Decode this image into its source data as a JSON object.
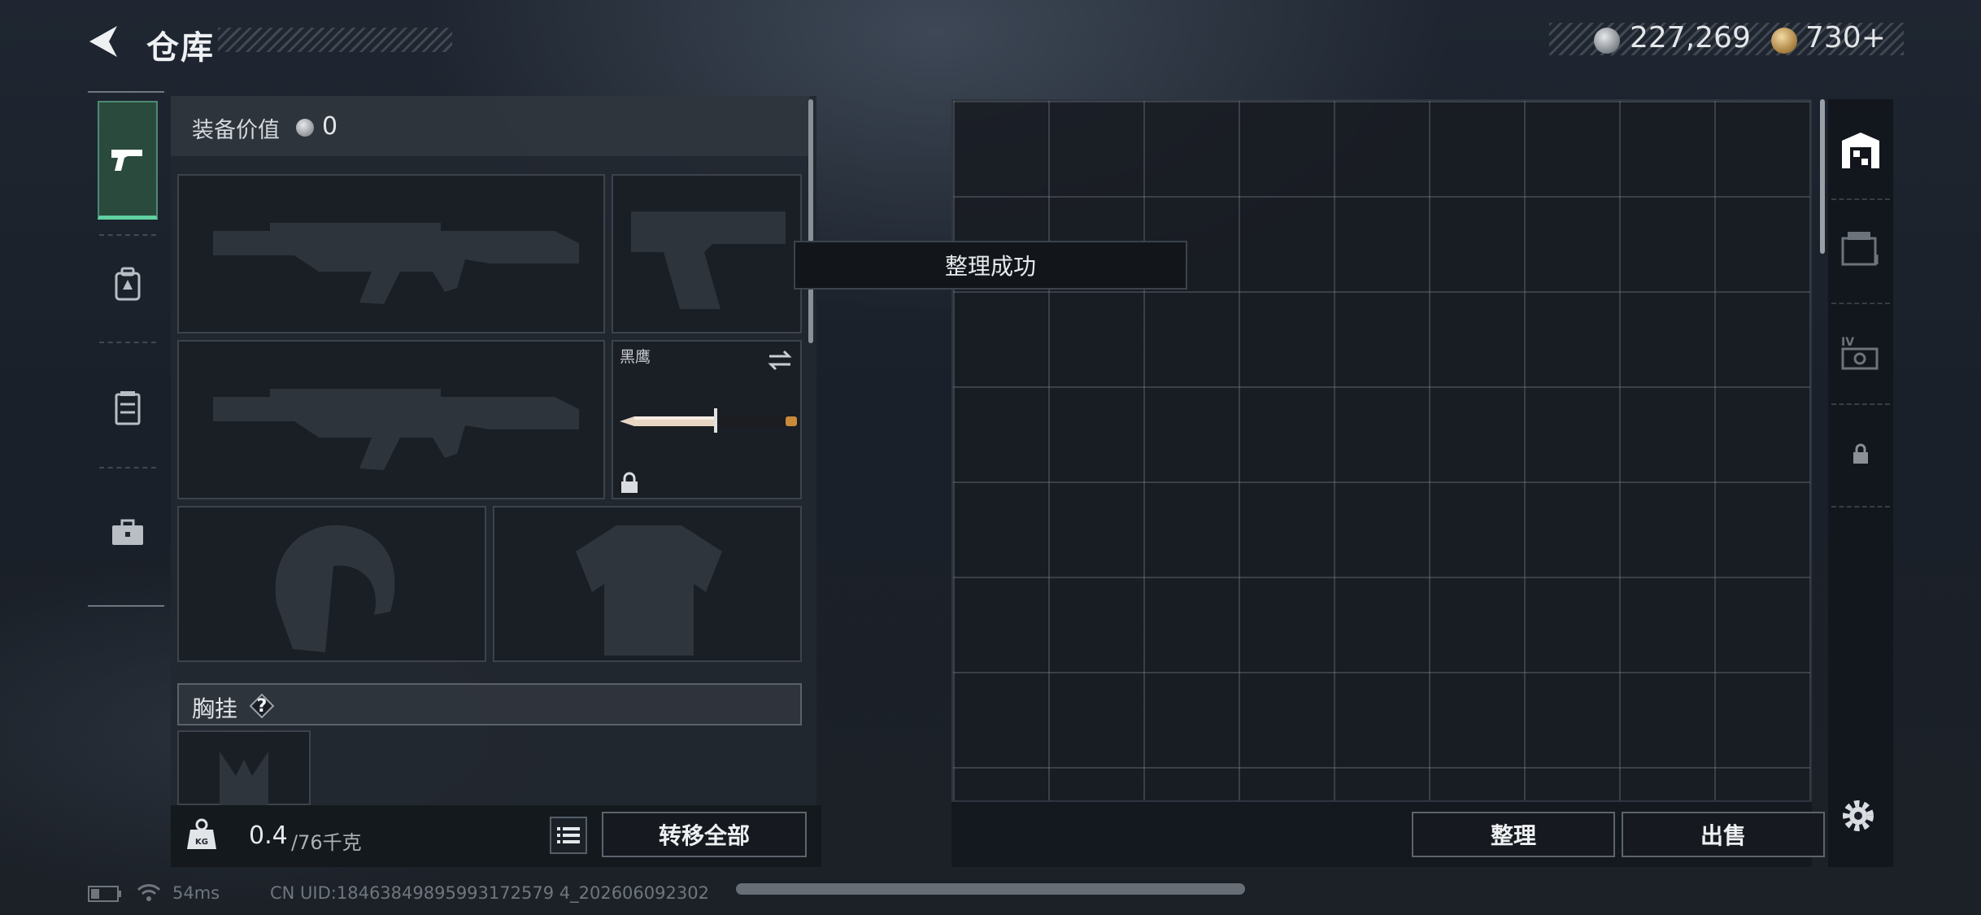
{
  "header": {
    "title": "仓库",
    "currency_silver": "227,269",
    "currency_gold": "730+"
  },
  "left_sidebar": {
    "tabs": [
      {
        "icon": "pistol-icon",
        "active": true
      },
      {
        "icon": "backpack-icon",
        "active": false
      },
      {
        "icon": "rig-icon",
        "active": false
      },
      {
        "icon": "briefcase-icon",
        "active": false
      }
    ]
  },
  "equipment": {
    "value_label": "装备价值",
    "value": "0",
    "melee_name": "黑鹰",
    "chest_label": "胸挂",
    "help_symbol": "?",
    "weight_current": "0.4",
    "weight_max": "/76千克",
    "transfer_all_label": "转移全部"
  },
  "toast": {
    "message": "整理成功"
  },
  "storage": {
    "sort_label": "整理",
    "sell_label": "出售"
  },
  "right_sidebar": {
    "tabs": [
      "storage-icon",
      "crate-icon",
      "level-crate-icon",
      "lock-icon"
    ]
  },
  "status_bar": {
    "ping": "54ms",
    "uid": "CN UID:18463849895993172579 4_202606092302"
  },
  "colors": {
    "accent_green": "#5fd1a0",
    "panel_bg": "#222830",
    "border": "#5c646d"
  }
}
